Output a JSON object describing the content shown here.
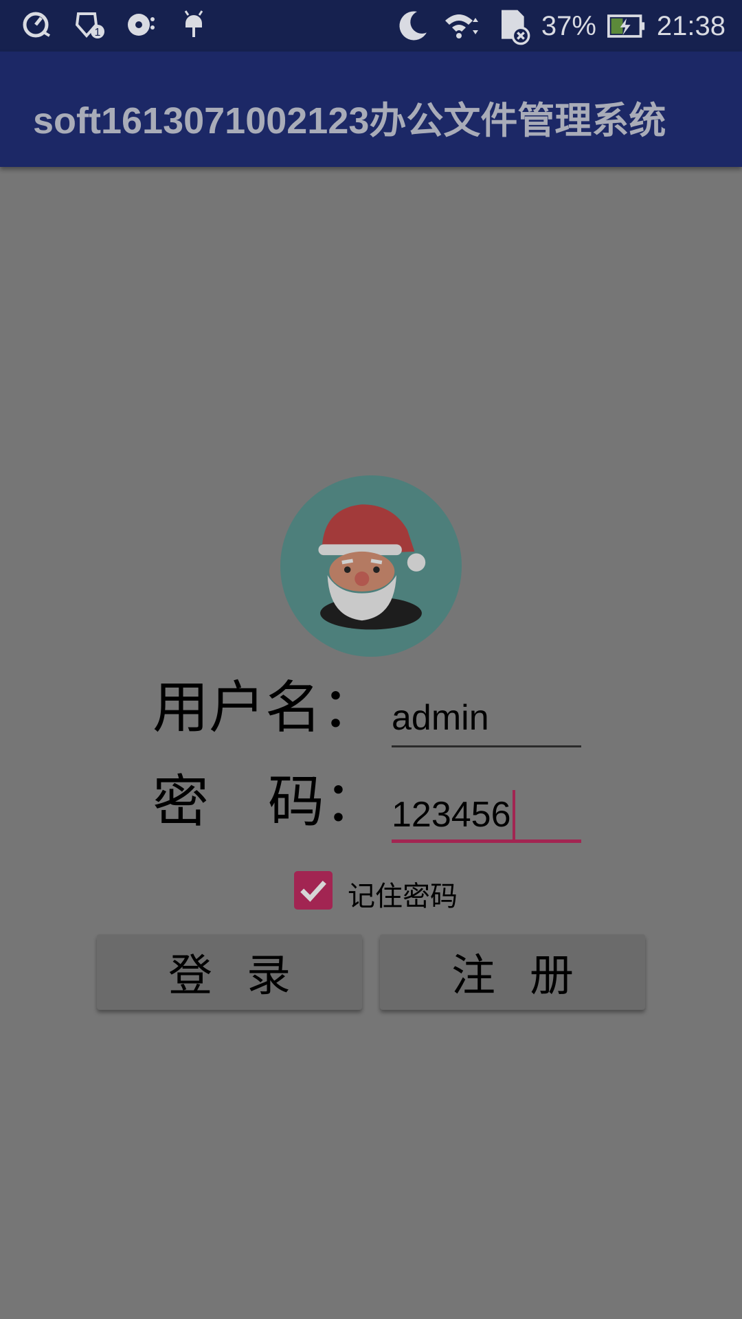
{
  "status_bar": {
    "battery": "37%",
    "time": "21:38",
    "icons_left": [
      "speedometer-icon",
      "shield-badge-icon",
      "disc-icon",
      "android-icon"
    ],
    "icons_right": [
      "moon-icon",
      "wifi-icon",
      "sd-card-off-icon",
      "battery-charging-icon"
    ]
  },
  "app_bar": {
    "title": "soft1613071002123办公文件管理系统"
  },
  "login_form": {
    "username_label": "用户名：",
    "password_label_1": "密",
    "password_label_2": "码：",
    "username_value": "admin",
    "password_value": "123456",
    "remember_label": "记住密码",
    "remember_checked": true,
    "login_button": "登录",
    "register_button": "注册"
  },
  "colors": {
    "accent": "#a22552",
    "background": "#767676",
    "appbar": "#1c2866"
  }
}
